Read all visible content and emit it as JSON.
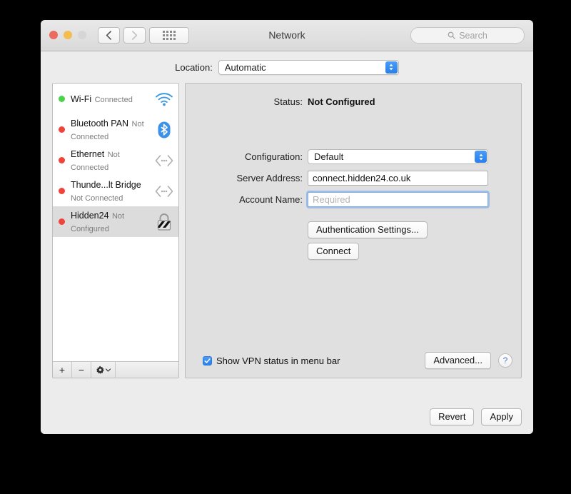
{
  "window": {
    "title": "Network",
    "traffic_lights": [
      "close",
      "minimize",
      "zoom"
    ],
    "back_label": "Back",
    "forward_label": "Forward",
    "show_all_label": "Show All",
    "search_placeholder": "Search"
  },
  "location": {
    "label": "Location:",
    "value": "Automatic"
  },
  "sidebar": {
    "services": [
      {
        "name": "Wi-Fi",
        "state": "Connected",
        "dot": "#4cd24c",
        "icon": "wifi-icon",
        "selected": false
      },
      {
        "name": "Bluetooth PAN",
        "state": "Not Connected",
        "dot": "#f0433a",
        "icon": "bluetooth-icon",
        "selected": false
      },
      {
        "name": "Ethernet",
        "state": "Not Connected",
        "dot": "#f0433a",
        "icon": "ethernet-icon",
        "selected": false
      },
      {
        "name": "Thunde...lt Bridge",
        "state": "Not Connected",
        "dot": "#f0433a",
        "icon": "thunderbolt-bridge-icon",
        "selected": false
      },
      {
        "name": "Hidden24",
        "state": "Not Configured",
        "dot": "#f0433a",
        "icon": "vpn-lock-icon",
        "selected": true
      }
    ],
    "toolbar": {
      "add_label": "+",
      "remove_label": "−",
      "actions_label": "gear-icon"
    }
  },
  "main": {
    "status_label": "Status:",
    "status_value": "Not Configured",
    "configuration_label": "Configuration:",
    "configuration_value": "Default",
    "server_address_label": "Server Address:",
    "server_address_value": "connect.hidden24.co.uk",
    "account_name_label": "Account Name:",
    "account_name_value": "",
    "account_name_placeholder": "Required",
    "auth_settings_label": "Authentication Settings...",
    "connect_label": "Connect",
    "show_vpn_status_label": "Show VPN status in menu bar",
    "show_vpn_status_checked": true,
    "advanced_label": "Advanced...",
    "help_label": "?"
  },
  "footer": {
    "revert_label": "Revert",
    "apply_label": "Apply"
  },
  "colors": {
    "accent_blue": "#2a80ed",
    "connected_green": "#4cd24c",
    "disconnected_red": "#f0433a",
    "window_bg": "#ececec",
    "panel_bg": "#e0e0e0"
  }
}
